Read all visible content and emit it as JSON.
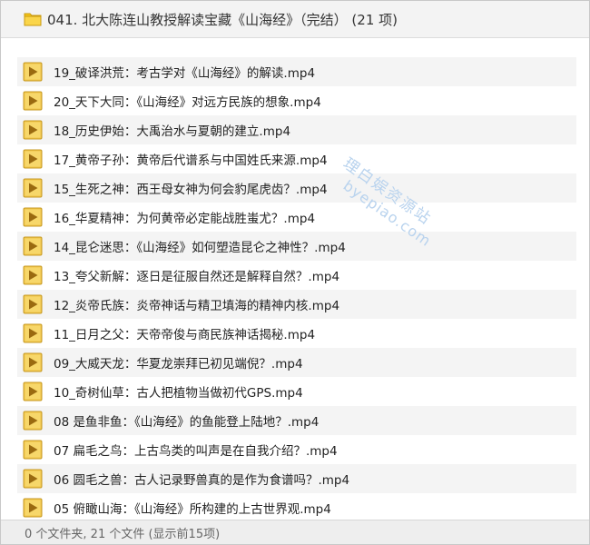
{
  "header": {
    "folder_icon": "folder-icon",
    "title": "041. 北大陈连山教授解读宝藏《山海经》（完结） (21 项)"
  },
  "files": [
    {
      "name": "19_破译洪荒：考古学对《山海经》的解读.mp4",
      "icon": "media-play-icon"
    },
    {
      "name": "20_天下大同：《山海经》对远方民族的想象.mp4",
      "icon": "media-play-icon"
    },
    {
      "name": "18_历史伊始：大禹治水与夏朝的建立.mp4",
      "icon": "media-play-icon"
    },
    {
      "name": "17_黄帝子孙：黄帝后代谱系与中国姓氏来源.mp4",
      "icon": "media-play-icon"
    },
    {
      "name": "15_生死之神：西王母女神为何会豹尾虎齿？.mp4",
      "icon": "media-play-icon"
    },
    {
      "name": "16_华夏精神：为何黄帝必定能战胜蚩尤？.mp4",
      "icon": "media-play-icon"
    },
    {
      "name": "14_昆仑迷思：《山海经》如何塑造昆仑之神性？.mp4",
      "icon": "media-play-icon"
    },
    {
      "name": "13_夸父新解：逐日是征服自然还是解释自然？.mp4",
      "icon": "media-play-icon"
    },
    {
      "name": "12_炎帝氏族：炎帝神话与精卫填海的精神内核.mp4",
      "icon": "media-play-icon"
    },
    {
      "name": "11_日月之父：天帝帝俊与商民族神话揭秘.mp4",
      "icon": "media-play-icon"
    },
    {
      "name": "09_大威天龙：华夏龙崇拜已初见端倪？.mp4",
      "icon": "media-play-icon"
    },
    {
      "name": "10_奇树仙草：古人把植物当做初代GPS.mp4",
      "icon": "media-play-icon"
    },
    {
      "name": "08 是鱼非鱼：《山海经》的鱼能登上陆地？.mp4",
      "icon": "media-play-icon"
    },
    {
      "name": "07 扁毛之鸟：上古鸟类的叫声是在自我介绍？.mp4",
      "icon": "media-play-icon"
    },
    {
      "name": "06 圆毛之兽：古人记录野兽真的是作为食谱吗？.mp4",
      "icon": "media-play-icon"
    },
    {
      "name": "05 俯瞰山海：《山海经》所构建的上古世界观.mp4",
      "icon": "media-play-icon"
    }
  ],
  "status": {
    "text": "0 个文件夹, 21 个文件 (显示前15项)"
  },
  "watermark": {
    "line1": "理白娱资源站",
    "line2": "byepiao.com"
  },
  "colors": {
    "folder": "#f5c518",
    "play_box": "#f0c64a",
    "play_triangle": "#9a6a10",
    "watermark": "#b9d3ee"
  }
}
